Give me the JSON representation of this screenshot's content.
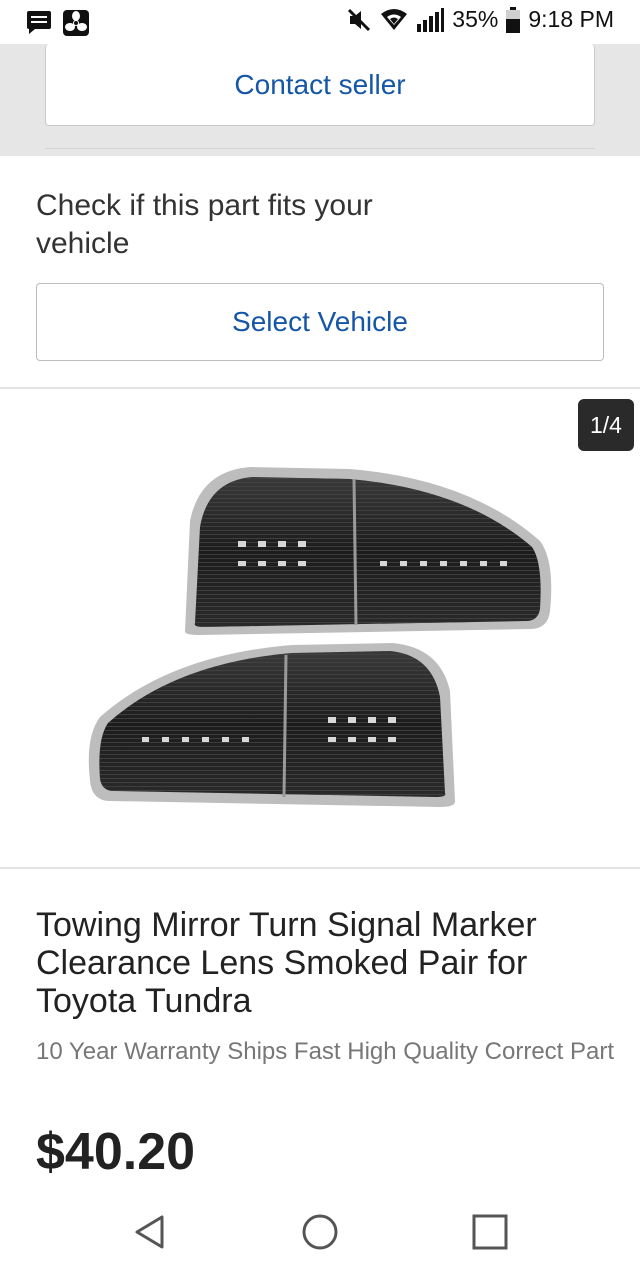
{
  "status_bar": {
    "left_icons": [
      "message-icon",
      "fan-icon"
    ],
    "right_icons": [
      "mute-icon",
      "wifi-icon",
      "signal-icon",
      "battery-icon"
    ],
    "battery_percent": "35%",
    "time": "9:18 PM"
  },
  "contact": {
    "label": "Contact seller"
  },
  "fitment": {
    "title": "Check if this part fits your vehicle",
    "button_label": "Select Vehicle"
  },
  "gallery": {
    "counter": "1/4"
  },
  "product": {
    "title": "Towing Mirror Turn Signal Marker Clearance Lens Smoked Pair for Toyota Tundra",
    "subtitle": "10 Year Warranty Ships Fast High Quality Correct Part",
    "price": "$40.20"
  },
  "nav_bar": {
    "buttons": [
      "back-icon",
      "home-icon",
      "recents-icon"
    ]
  },
  "colors": {
    "accent": "#1556a8",
    "band": "#e6e6e6",
    "counter_bg": "#2a2a2a"
  }
}
